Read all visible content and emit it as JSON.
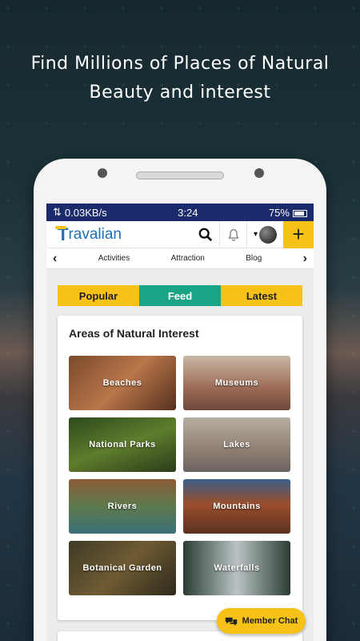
{
  "promo": {
    "line1": "Find Millions of Places of Natural",
    "line2": "Beauty and interest"
  },
  "statusbar": {
    "speed": "0.03KB/s",
    "time": "3:24",
    "battery": "75%"
  },
  "app": {
    "logo": "ravalian",
    "logo_initial": "T"
  },
  "nav": {
    "items": [
      "Activities",
      "Attraction",
      "Blog"
    ]
  },
  "tabs": [
    {
      "label": "Popular",
      "active": false
    },
    {
      "label": "Feed",
      "active": true
    },
    {
      "label": "Latest",
      "active": false
    }
  ],
  "section": {
    "title": "Areas of Natural Interest",
    "tiles": [
      "Beaches",
      "Museums",
      "National Parks",
      "Lakes",
      "Rivers",
      "Mountains",
      "Botanical Garden",
      "Waterfalls"
    ]
  },
  "chat": {
    "label": "Member Chat"
  },
  "colors": {
    "accent": "#f6c218",
    "active_tab": "#1aa486",
    "statusbar": "#1b2a6b"
  }
}
